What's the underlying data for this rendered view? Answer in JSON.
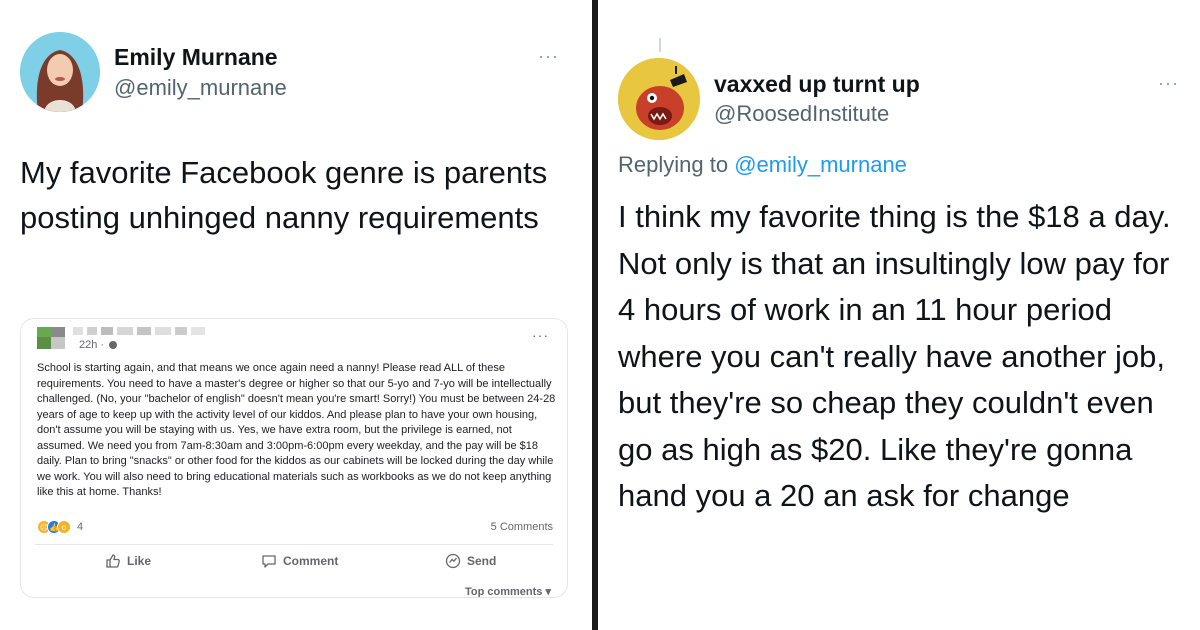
{
  "left_tweet": {
    "author_name": "Emily Murnane",
    "author_handle": "@emily_murnane",
    "more_icon": "more-horizontal-icon",
    "text": "My favorite Facebook genre is parents posting unhinged nanny requirements",
    "embedded_post": {
      "timestamp": "22h ·",
      "body": "School is starting again, and that means we once again need a nanny! Please read ALL of these requirements. You need to have a master's degree or higher so that our 5-yo and 7-yo will be intellectually challenged. (No, your \"bachelor of english\" doesn't mean you're smart! Sorry!) You must be between 24-28 years of age to keep up with the activity level of our kiddos. And please plan to have your own housing, don't assume you will be staying with us. Yes, we have extra room, but the privilege is earned, not assumed. We need you from 7am-8:30am and 3:00pm-6:00pm every weekday, and the pay will be $18 daily. Plan to bring \"snacks\" or other food for the kiddos as our cabinets will be locked during the day while we work. You will also need to bring educational materials such as workbooks as we do not keep anything like this at home. Thanks!",
      "reaction_count": "4",
      "comments_count": "5 Comments",
      "actions": {
        "like": "Like",
        "comment": "Comment",
        "send": "Send"
      },
      "top_comments": "Top comments ▾"
    }
  },
  "right_tweet": {
    "author_name": "vaxxed up turnt up",
    "author_handle": "@RoosedInstitute",
    "more_icon": "more-horizontal-icon",
    "replying_prefix": "Replying to ",
    "replying_to": "@emily_murnane",
    "text": "I think my favorite thing is the $18 a day. Not only is that an insultingly low pay for 4 hours of work in an 11 hour period where you can't really have another job, but they're so cheap they couldn't even go as high as $20. Like they're gonna hand you a 20 an ask for change"
  },
  "colors": {
    "twitter_blue": "#1d9bf0",
    "secondary_text": "#536471",
    "divider": "#1a1a1a"
  }
}
